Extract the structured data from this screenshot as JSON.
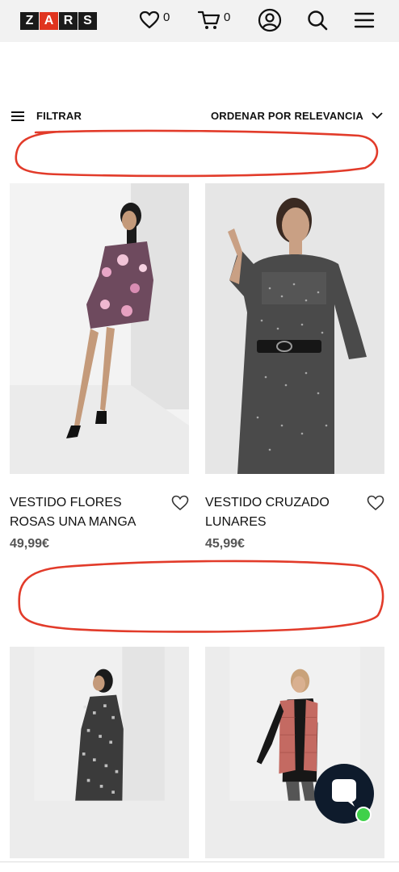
{
  "header": {
    "logo_letters": [
      "Z",
      "A",
      "R",
      "S"
    ],
    "wishlist_count": "0",
    "cart_count": "0",
    "icons": {
      "wishlist": "heart-icon",
      "cart": "cart-icon",
      "account": "user-icon",
      "search": "search-icon",
      "menu": "hamburger-menu-icon"
    }
  },
  "toolbar": {
    "filter_label": "FILTRAR",
    "sort_label": "ORDENAR POR RELEVANCIA"
  },
  "products": [
    {
      "name": "VESTIDO FLORES ROSAS UNA MANGA",
      "price": "49,99€"
    },
    {
      "name": "VESTIDO CRUZADO LUNARES",
      "price": "45,99€"
    },
    {
      "name": "",
      "price": ""
    },
    {
      "name": "",
      "price": ""
    }
  ],
  "colors": {
    "logo_dark": "#1a1a1a",
    "logo_accent": "#e0341f",
    "annotation_red": "#e23b2a",
    "chat_bg": "#0e1b2c",
    "online_green": "#3fd14a"
  }
}
